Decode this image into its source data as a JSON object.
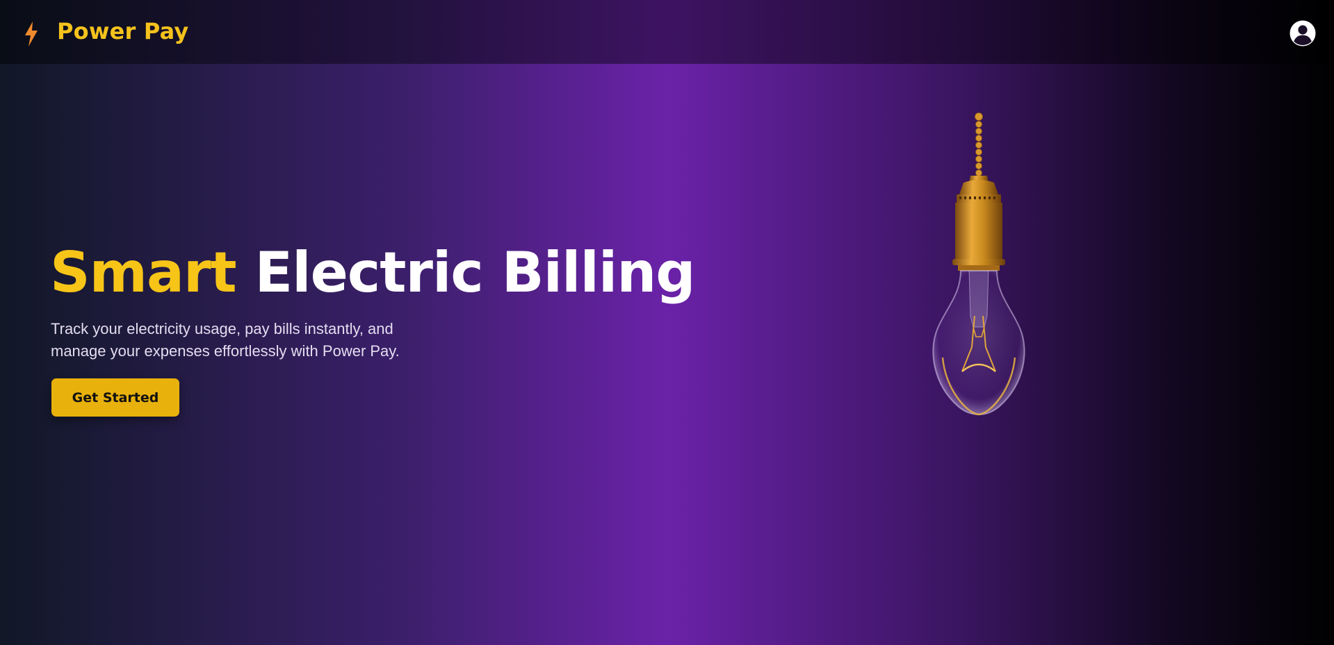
{
  "header": {
    "brand": "Power Pay",
    "logo_icon": "lightning-bolt-icon",
    "profile_icon": "user-circle-icon"
  },
  "hero": {
    "title_accent": "Smart",
    "title_rest": "Electric Billing",
    "subtitle_line1": "Track your electricity usage, pay bills instantly, and",
    "subtitle_line2": "manage your expenses effortlessly with Power Pay.",
    "cta_label": "Get Started",
    "illustration": "hanging-light-bulb-icon"
  },
  "colors": {
    "accent": "#f6c518",
    "button": "#e9b10c",
    "bolt": "#f08a2e",
    "bulb_gold": "#c98a1e",
    "background_mid": "#6a22a8"
  }
}
